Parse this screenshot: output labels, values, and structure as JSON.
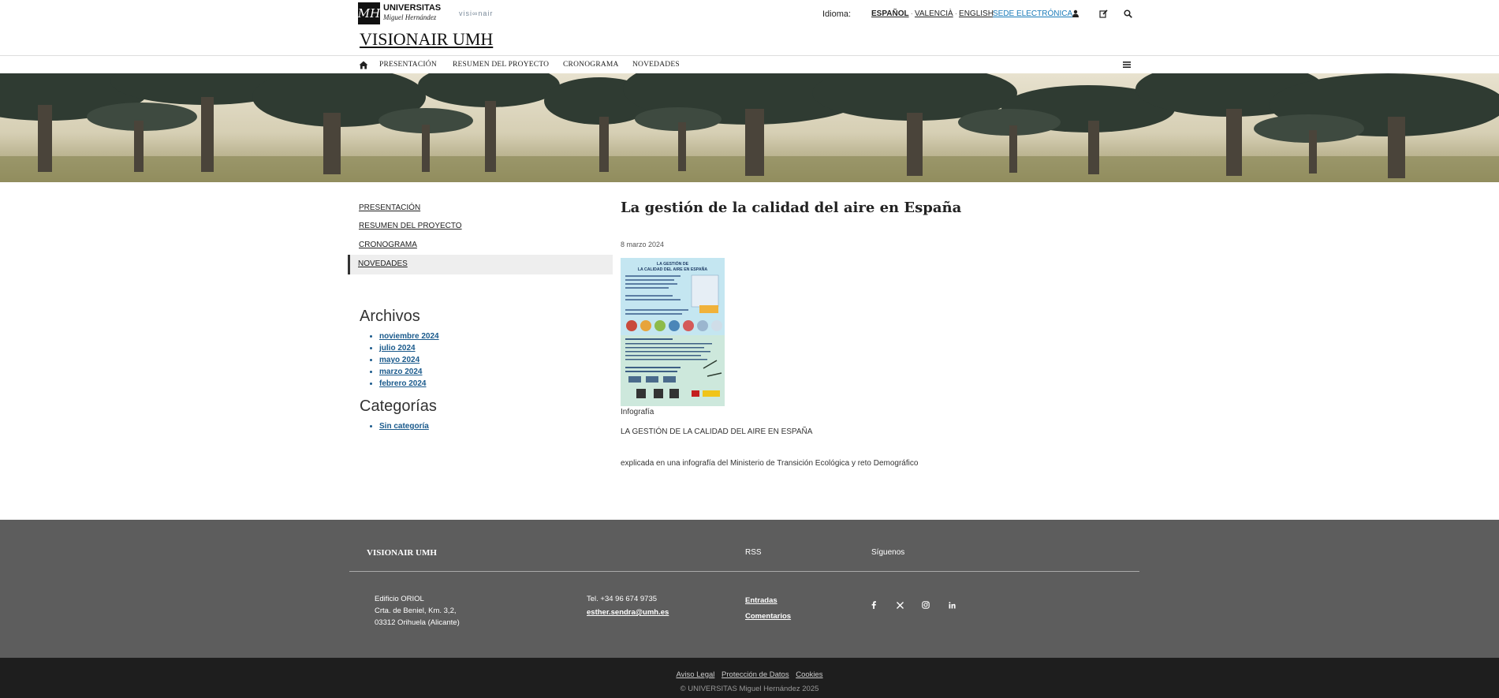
{
  "header": {
    "logo_name": "UNIVERSITAS",
    "logo_sub": "Miguel Hernández",
    "logo_glyph": "MH",
    "visionair_mark": "visi∞nair",
    "site_title": "VISIONAIR UMH",
    "idioma_label": "Idioma:",
    "languages": [
      "ESPAÑOL",
      "VALENCIÀ",
      "ENGLISH"
    ],
    "sede": "SEDE ELECTRÓNICA"
  },
  "nav": {
    "items": [
      "PRESENTACIÓN",
      "RESUMEN DEL PROYECTO",
      "CRONOGRAMA",
      "NOVEDADES"
    ]
  },
  "sidebar": {
    "links": [
      "PRESENTACIÓN",
      "RESUMEN DEL PROYECTO",
      "CRONOGRAMA",
      "NOVEDADES"
    ],
    "archivos_title": "Archivos",
    "archivos": [
      "noviembre 2024",
      "julio 2024",
      "mayo 2024",
      "marzo 2024",
      "febrero 2024"
    ],
    "categorias_title": "Categorías",
    "categorias": [
      "Sin categoría"
    ]
  },
  "post": {
    "title": "La gestión de la calidad del aire en España",
    "date": "8 marzo 2024",
    "caption": "Infografía",
    "line1": "LA GESTIÓN DE LA CALIDAD DEL AIRE EN ESPAÑA",
    "line2": "explicada en una infografía del Ministerio de Transición Ecológica y reto Demográfico",
    "thumb_title": "LA GESTIÓN DE LA CALIDAD DEL AIRE EN ESPAÑA"
  },
  "footer": {
    "title": "VISIONAIR UMH",
    "rss": "RSS",
    "siguenos": "Síguenos",
    "address": [
      "Edificio ORIOL",
      "Crta. de Beniel, Km. 3,2,",
      "03312 Orihuela (Alicante)"
    ],
    "tel": "Tel. +34 96 674 9735",
    "email": "esther.sendra@umh.es",
    "rss_links": [
      "Entradas",
      "Comentarios"
    ],
    "bottom_links": [
      "Aviso Legal",
      "Protección de Datos",
      "Cookies"
    ],
    "copyright": "© UNIVERSITAS Miguel Hernández 2025"
  },
  "colors": {
    "link_blue": "#1a7bb9",
    "footer_bg": "#5d5d5d",
    "bottom_bg": "#1e1e1e"
  }
}
